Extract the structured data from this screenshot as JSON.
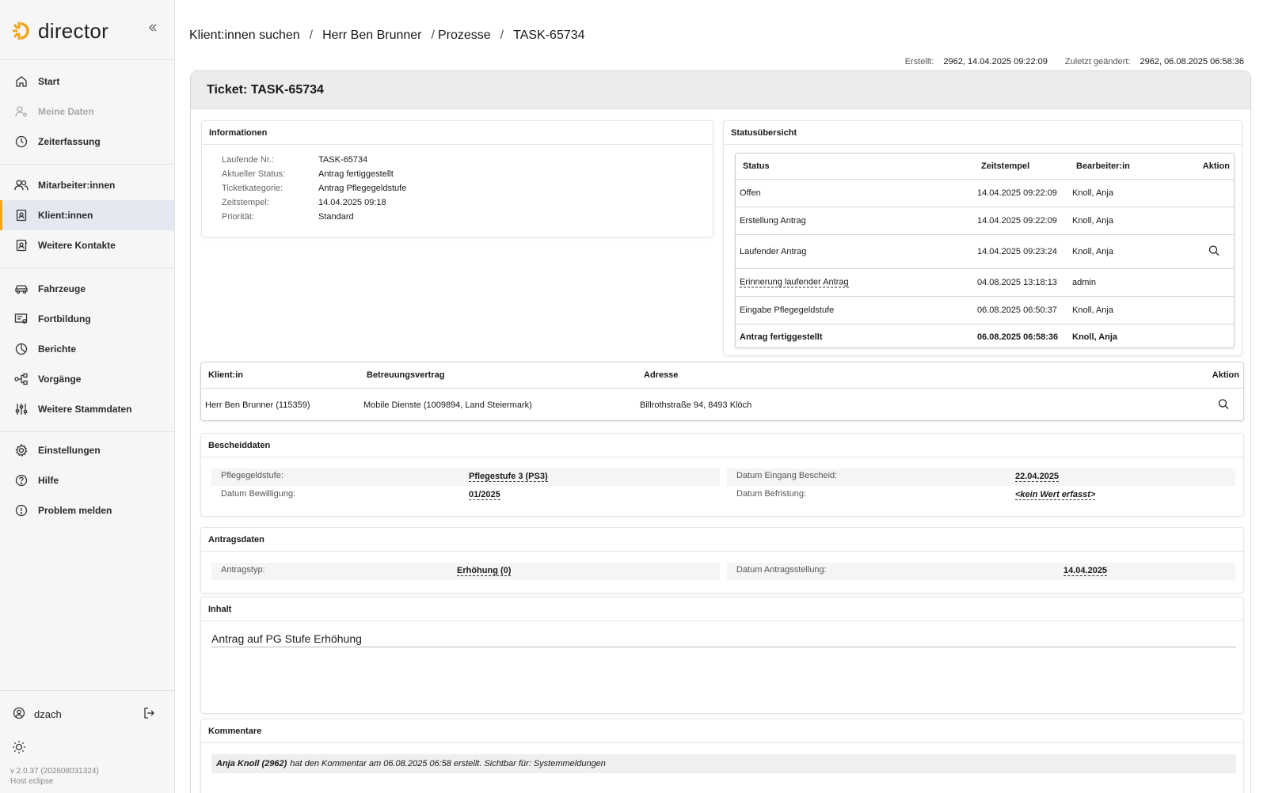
{
  "app": {
    "name": "director",
    "accent": "#f2a51a",
    "collapse_icon": "double-chevron-left-icon"
  },
  "sidebar": {
    "items": [
      {
        "label": "Start",
        "icon": "home-icon"
      },
      {
        "label": "Meine Daten",
        "icon": "user-settings-icon",
        "disabled": true
      },
      {
        "label": "Zeiterfassung",
        "icon": "clock-icon"
      },
      {
        "label": "Mitarbeiter:innen",
        "icon": "users-icon"
      },
      {
        "label": "Klient:innen",
        "icon": "client-badge-icon",
        "active": true
      },
      {
        "label": "Weitere Kontakte",
        "icon": "contact-badge-icon"
      },
      {
        "label": "Fahrzeuge",
        "icon": "car-icon"
      },
      {
        "label": "Fortbildung",
        "icon": "training-icon"
      },
      {
        "label": "Berichte",
        "icon": "pie-chart-icon"
      },
      {
        "label": "Vorgänge",
        "icon": "workflow-icon"
      },
      {
        "label": "Weitere Stammdaten",
        "icon": "sliders-icon"
      },
      {
        "label": "Einstellungen",
        "icon": "gear-icon"
      },
      {
        "label": "Hilfe",
        "icon": "help-icon"
      },
      {
        "label": "Problem melden",
        "icon": "alert-icon"
      }
    ],
    "user": "dzach",
    "version": "v 2.0.37 (202608031324)",
    "host": "Host eclipse"
  },
  "breadcrumb": [
    "Klient:innen suchen",
    "Herr Ben Brunner",
    "Prozesse",
    "TASK-65734"
  ],
  "meta": {
    "created_label": "Erstellt:",
    "created_value": "2962, 14.04.2025 09:22:09",
    "changed_label": "Zuletzt geändert:",
    "changed_value": "2962, 06.08.2025 06:58:36"
  },
  "ticket": {
    "title": "Ticket: TASK-65734",
    "info": {
      "title": "Informationen",
      "rows": [
        {
          "label": "Laufende Nr.:",
          "value": "TASK-65734"
        },
        {
          "label": "Aktueller Status:",
          "value": "Antrag fertiggestellt"
        },
        {
          "label": "Ticketkategorie:",
          "value": "Antrag Pflegegeldstufe"
        },
        {
          "label": "Zeitstempel:",
          "value": "14.04.2025 09:18"
        },
        {
          "label": "Priorität:",
          "value": "Standard"
        }
      ]
    },
    "status": {
      "title": "Statusübersicht",
      "headers": [
        "Status",
        "Zeitstempel",
        "Bearbeiter:in",
        "Aktion"
      ],
      "rows": [
        {
          "status": "Offen",
          "time": "14.04.2025 09:22:09",
          "user": "Knoll, Anja"
        },
        {
          "status": "Erstellung Antrag",
          "time": "14.04.2025 09:22:09",
          "user": "Knoll, Anja"
        },
        {
          "status": "Laufender Antrag",
          "time": "14.04.2025 09:23:24",
          "user": "Knoll, Anja",
          "action": "search-icon"
        },
        {
          "status": "Erinnerung laufender Antrag",
          "time": "04.08.2025 13:18:13",
          "user": "admin"
        },
        {
          "status": "Eingabe Pflegegeldstufe",
          "time": "06.08.2025 06:50:37",
          "user": "Knoll, Anja"
        },
        {
          "status": "Antrag fertiggestellt",
          "time": "06.08.2025 06:58:36",
          "user": "Knoll, Anja"
        }
      ]
    },
    "client": {
      "headers": [
        "Klient:in",
        "Betreuungsvertrag",
        "Adresse",
        "Aktion"
      ],
      "row": {
        "client": "Herr Ben Brunner (115359)",
        "contract": "Mobile Dienste (1009894, Land Steiermark)",
        "address": "Billrothstraße 94, 8493 Klöch"
      }
    },
    "bescheid": {
      "title": "Bescheiddaten",
      "pg_label": "Pflegegeldstufe:",
      "pg_value": "Pflegestufe 3 (PS3)",
      "eingang_label": "Datum Eingang Bescheid:",
      "eingang_value": "22.04.2025",
      "bewilligung_label": "Datum Bewilligung:",
      "bewilligung_value": "01/2025",
      "befristung_label": "Datum Befristung:",
      "befristung_value": "<kein Wert erfasst>"
    },
    "antrag": {
      "title": "Antragsdaten",
      "typ_label": "Antragstyp:",
      "typ_value": "Erhöhung (0)",
      "datum_label": "Datum Antragsstellung:",
      "datum_value": "14.04.2025"
    },
    "inhalt": {
      "title": "Inhalt",
      "text": "Antrag auf PG Stufe Erhöhung"
    },
    "kommentare": {
      "title": "Kommentare",
      "author": "Anja Knoll (2962)",
      "text": "hat den Kommentar am 06.08.2025 06:58 erstellt. Sichtbar für: Systemmeldungen"
    }
  }
}
